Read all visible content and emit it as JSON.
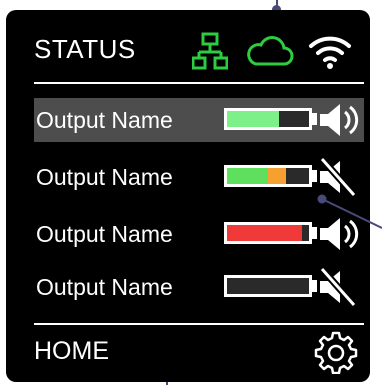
{
  "header": {
    "title": "STATUS",
    "icons": [
      "network-icon",
      "cloud-icon",
      "wifi-icon"
    ]
  },
  "outputs": [
    {
      "label": "Output Name",
      "selected": true,
      "level": [
        {
          "color": "#7ef08a",
          "fraction": 0.63
        }
      ],
      "muted": false
    },
    {
      "label": "Output Name",
      "selected": false,
      "level": [
        {
          "color": "#5ee05e",
          "fraction": 0.5
        },
        {
          "color": "#f5a030",
          "fraction": 0.22
        }
      ],
      "muted": true
    },
    {
      "label": "Output Name",
      "selected": false,
      "level": [
        {
          "color": "#f03a3a",
          "fraction": 0.92
        }
      ],
      "muted": false
    },
    {
      "label": "Output Name",
      "selected": false,
      "level": [],
      "muted": true
    }
  ],
  "footer": {
    "home_label": "HOME",
    "settings_icon": "gear-icon"
  },
  "colors": {
    "accent_green": "#2ecc40",
    "background": "#000000",
    "selected_row": "#4d4d4d"
  }
}
